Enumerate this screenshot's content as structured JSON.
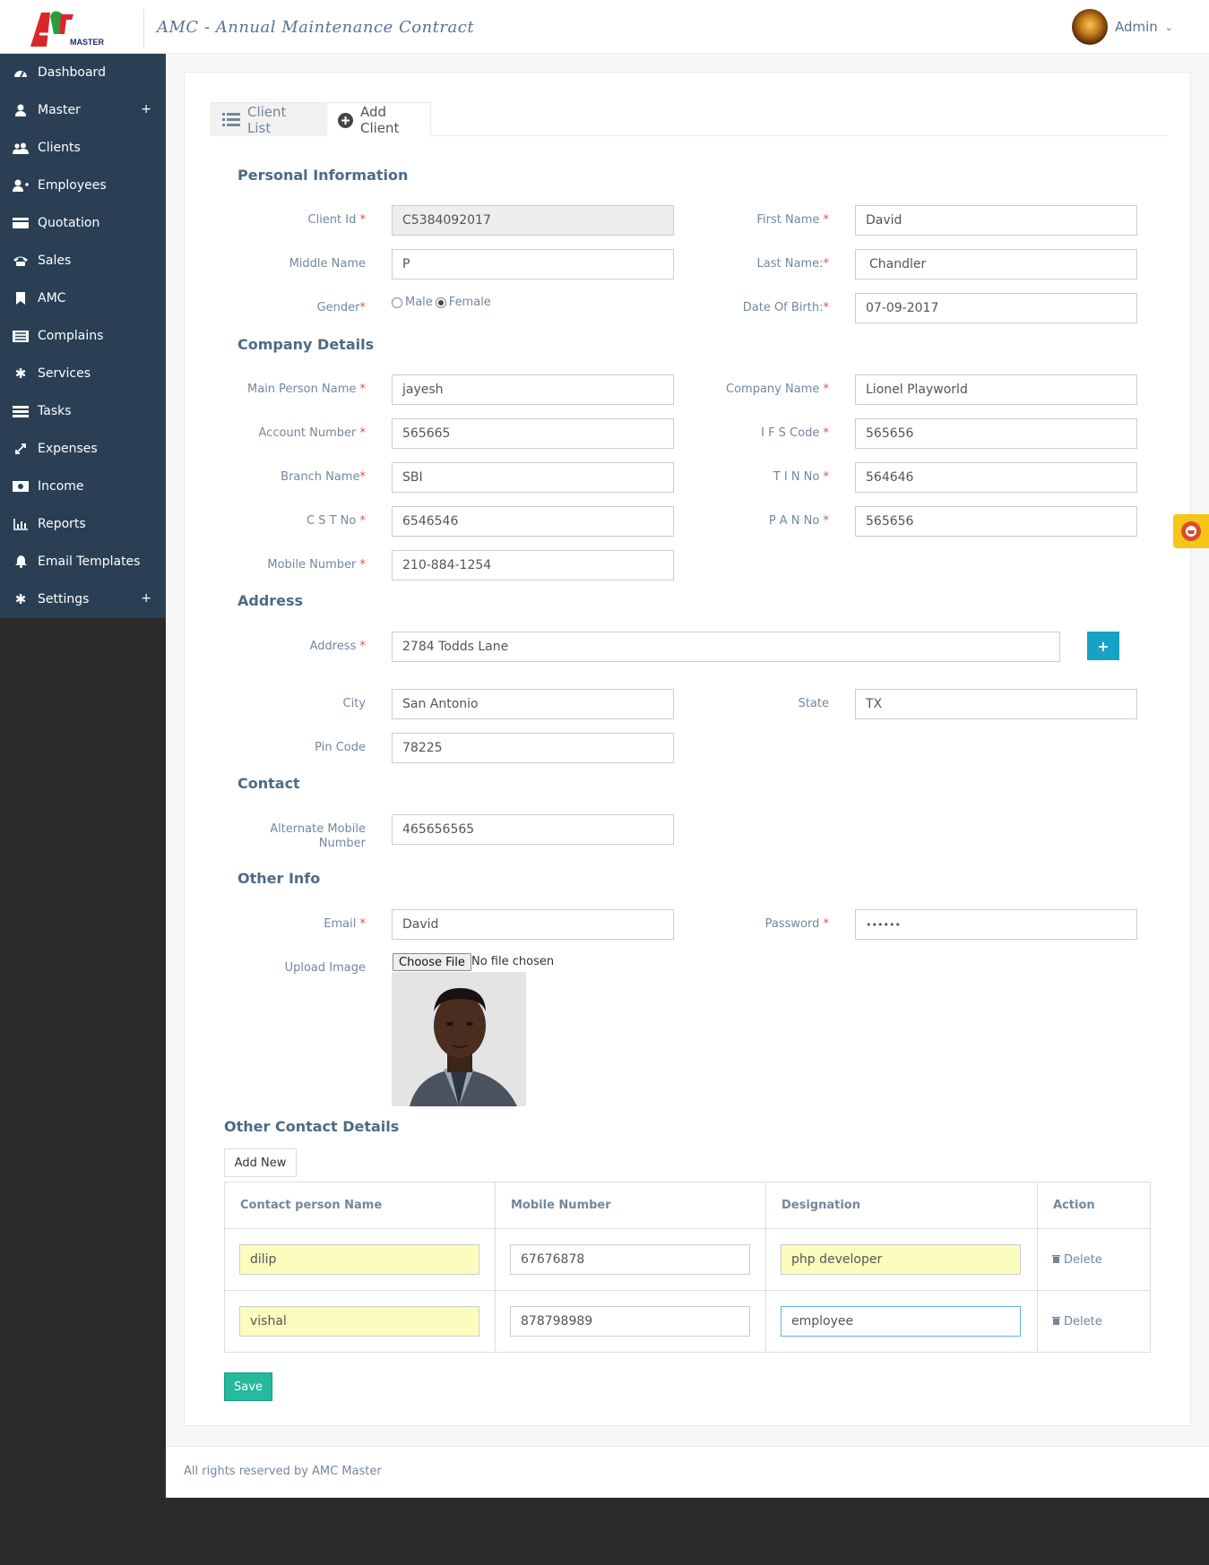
{
  "header": {
    "title": "AMC - Annual Maintenance Contract",
    "user_name": "Admin",
    "logo_text": "MASTER"
  },
  "sidebar": {
    "items": [
      {
        "label": "Dashboard",
        "icon": "dashboard-icon"
      },
      {
        "label": "Master",
        "icon": "user-icon",
        "expand": "+"
      },
      {
        "label": "Clients",
        "icon": "users-icon"
      },
      {
        "label": "Employees",
        "icon": "user-plus-icon"
      },
      {
        "label": "Quotation",
        "icon": "credit-card-icon"
      },
      {
        "label": "Sales",
        "icon": "phone-icon"
      },
      {
        "label": "AMC",
        "icon": "bookmark-icon"
      },
      {
        "label": "Complains",
        "icon": "list-alt-icon"
      },
      {
        "label": "Services",
        "icon": "gear-icon"
      },
      {
        "label": "Tasks",
        "icon": "tasks-icon"
      },
      {
        "label": "Expenses",
        "icon": "arrows-icon"
      },
      {
        "label": "Income",
        "icon": "money-icon"
      },
      {
        "label": "Reports",
        "icon": "bar-chart-icon"
      },
      {
        "label": "Email Templates",
        "icon": "bell-icon"
      },
      {
        "label": "Settings",
        "icon": "cog-icon",
        "expand": "+"
      }
    ]
  },
  "tabs": {
    "client_list": "Client List",
    "add_client": "Add Client"
  },
  "sections": {
    "personal": "Personal Information",
    "company": "Company Details",
    "address": "Address",
    "contact": "Contact",
    "other": "Other Info",
    "other_contacts": "Other Contact Details"
  },
  "labels": {
    "client_id": "Client Id",
    "first_name": "First Name",
    "middle_name": "Middle Name",
    "last_name": "Last Name:",
    "gender": "Gender",
    "dob": "Date Of Birth:",
    "main_person": "Main Person Name",
    "company_name": "Company Name",
    "account_number": "Account Number",
    "ifs_code": "I F S Code",
    "branch_name": "Branch Name",
    "tin_no": "T I N No",
    "cst_no": "C S T No",
    "pan_no": "P A N No",
    "mobile": "Mobile Number",
    "address": "Address",
    "city": "City",
    "state": "State",
    "pin": "Pin Code",
    "alt_mobile_1": "Alternate Mobile",
    "alt_mobile_2": "Number",
    "email": "Email",
    "password": "Password",
    "upload": "Upload Image",
    "male": "Male",
    "female": "Female",
    "req": "*"
  },
  "values": {
    "client_id": "C5384092017",
    "first_name": "David",
    "middle_name": "P",
    "last_name": "Chandler",
    "gender": "Female",
    "dob": "07-09-2017",
    "main_person": "jayesh",
    "company_name": "Lionel Playworld",
    "account_number": "565665",
    "ifs_code": "565656",
    "branch_name": "SBI",
    "tin_no": "564646",
    "cst_no": "6546546",
    "pan_no": "565656",
    "mobile": "210-884-1254",
    "address": "2784 Todds Lane",
    "city": "San Antonio",
    "state": "TX",
    "pin": "78225",
    "alt_mobile": "465656565",
    "email": "David",
    "password": "••••••"
  },
  "file": {
    "button": "Choose File",
    "status": "No file chosen"
  },
  "buttons": {
    "add_address": "+",
    "add_new": "Add New",
    "save": "Save"
  },
  "contacts_table": {
    "headers": [
      "Contact person Name",
      "Mobile Number",
      "Designation",
      "Action"
    ],
    "rows": [
      {
        "name": "dilip",
        "mobile": "67676878",
        "designation": "php developer",
        "action": "Delete"
      },
      {
        "name": "vishal",
        "mobile": "878798989",
        "designation": "employee",
        "action": "Delete"
      }
    ]
  },
  "footer": {
    "text": "All rights reserved by AMC Master"
  },
  "colors": {
    "sidebar": "#2a3f54",
    "save": "#26b99a",
    "plus": "#17a2c8",
    "required": "#d9534f",
    "autofill": "#fafdbd"
  }
}
